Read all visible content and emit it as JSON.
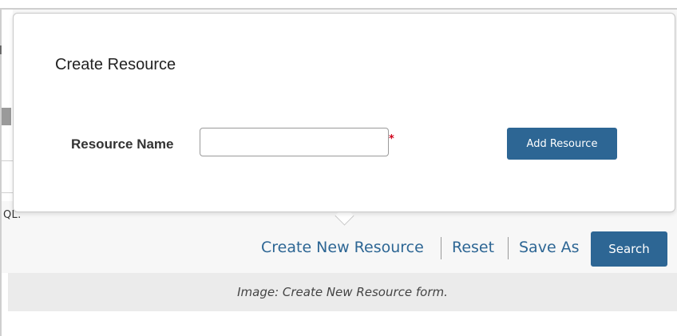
{
  "background": {
    "fragment_letter": "l",
    "hint_text": "QL."
  },
  "dialog": {
    "title": "Create Resource",
    "field_label": "Resource Name",
    "input_value": "",
    "required_mark": "*",
    "add_button_label": "Add Resource"
  },
  "actions": {
    "create_new_label": "Create New Resource",
    "reset_label": "Reset",
    "save_as_label": "Save As",
    "search_label": "Search"
  },
  "caption": "Image: Create New Resource form.",
  "colors": {
    "accent": "#2d6694",
    "required": "#d0021b",
    "caption_bg": "#ebebeb"
  }
}
